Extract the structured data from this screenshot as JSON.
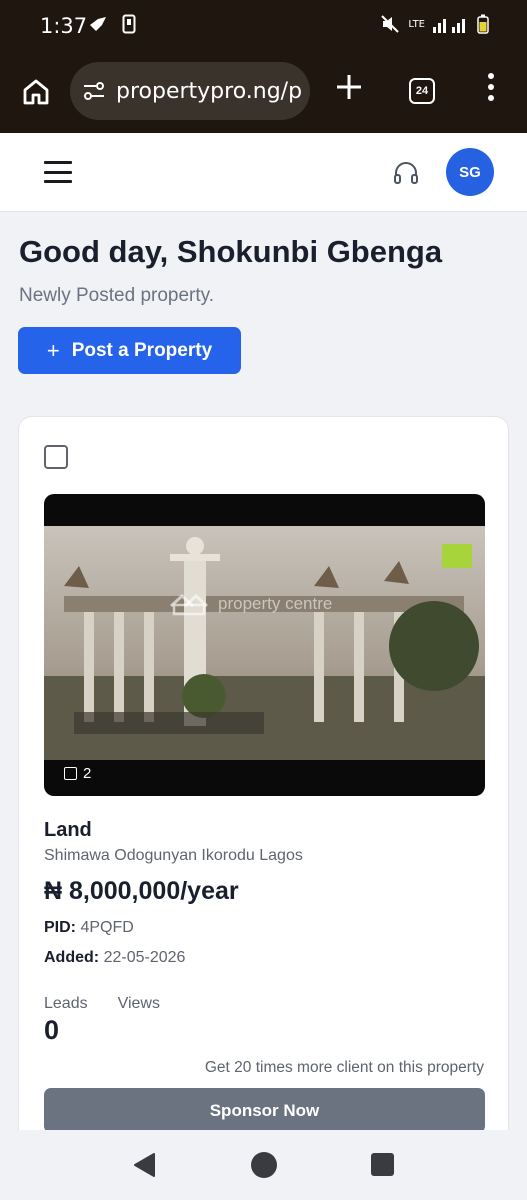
{
  "status_bar": {
    "time": "1:37",
    "network": "LTE"
  },
  "browser": {
    "url": "propertypro.ng/p",
    "tab_count": "24"
  },
  "header": {
    "avatar_initials": "SG"
  },
  "greeting": {
    "title": "Good day, Shokunbi Gbenga",
    "subtitle": "Newly Posted property.",
    "post_button_label": "Post a Property"
  },
  "listing": {
    "photo_count": "2",
    "watermark": "property centre",
    "type": "Land",
    "location": "Shimawa Odogunyan Ikorodu Lagos",
    "price": "₦ 8,000,000/year",
    "pid_label": "PID:",
    "pid_value": "4PQFD",
    "added_label": "Added:",
    "added_value": "22-05-2026",
    "leads_label": "Leads",
    "views_label": "Views",
    "leads_value": "0",
    "promo_text": "Get 20 times more client on this property",
    "sponsor_label": "Sponsor Now"
  },
  "icons": [
    "home-icon",
    "site-settings-icon",
    "new-tab-icon",
    "tab-switcher-icon",
    "overflow-menu-icon",
    "hamburger-menu-icon",
    "headset-icon",
    "plus-icon",
    "photo-count-icon",
    "back-icon",
    "home-nav-icon",
    "recents-icon"
  ]
}
